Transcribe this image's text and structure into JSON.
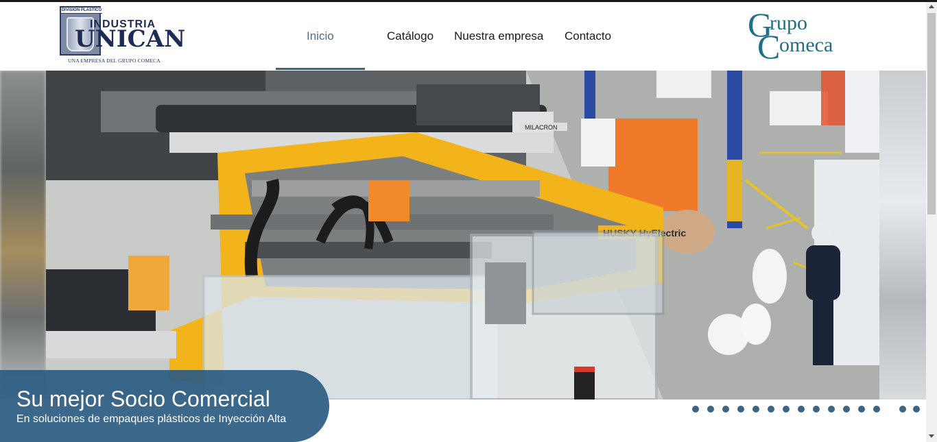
{
  "header": {
    "logo_left": {
      "badge": "DIVISION PLASTICO",
      "word_top": "INDUSTRIA",
      "word_main": "UNICAN",
      "tagline": "UNA EMPRESA DEL GRUPO COMECA"
    },
    "nav": [
      {
        "label": "Inicio",
        "active": true
      },
      {
        "label": "Catálogo",
        "active": false
      },
      {
        "label": "Nuestra empresa",
        "active": false
      },
      {
        "label": "Contacto",
        "active": false
      }
    ],
    "logo_right": {
      "line1_initial": "G",
      "line1_rest": "rupo",
      "line2_initial": "C",
      "line2_rest": "omeca"
    }
  },
  "hero": {
    "image_text": {
      "machine_brand": "MILACRON",
      "machine_model": "HUSKY HyElectric"
    },
    "caption_title": "Su mejor Socio Comercial",
    "caption_subtitle": "En soluciones de empaques plásticos de Inyección Alta",
    "slide_count": 14,
    "current_slide": 1
  },
  "colors": {
    "brand_blue": "#3d6483",
    "nav_active": "#4d6f8f",
    "logo_left": "#1d2c55",
    "logo_right": "#1f6f86",
    "machine_yellow": "#f2b31b"
  }
}
